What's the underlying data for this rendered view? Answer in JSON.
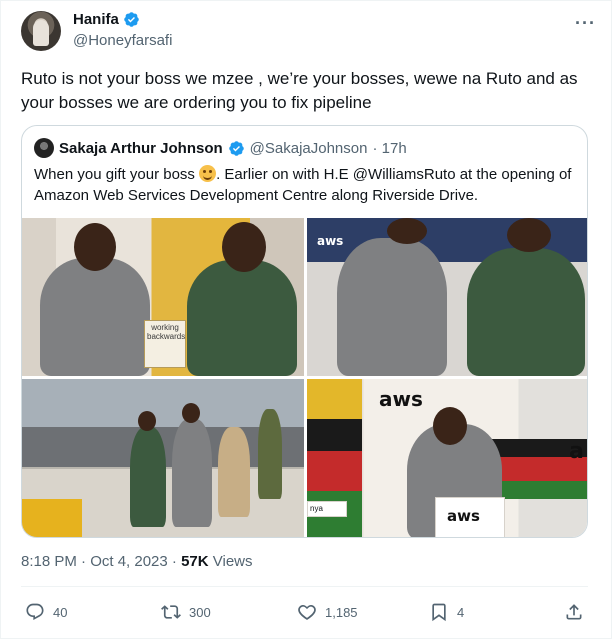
{
  "author": {
    "name": "Hanifa",
    "handle": "@Honeyfarsafi",
    "verified": true
  },
  "tweet": {
    "text": "Ruto is not your boss we mzee , we’re your bosses, wewe na Ruto and as your bosses we are ordering you to fix pipeline"
  },
  "quoted": {
    "name": "Sakaja Arthur Johnson",
    "handle": "@SakajaJohnson",
    "time": "· 17h",
    "text_before_emoji": "When you gift your boss ",
    "text_after_emoji": ". Earlier on with H.E @WilliamsRuto at the opening of Amazon Web Services Development Centre along Riverside Drive.",
    "book_label": "working backwards",
    "aws_logo_1": "aws",
    "aws_logo_2": "aws",
    "aws_logo_3": "aws",
    "sign_fragment": "nya"
  },
  "timestamp": {
    "time": "8:18 PM · Oct 4, 2023 · ",
    "views_count": "57K",
    "views_label": " Views"
  },
  "actions": {
    "replies": "40",
    "retweets": "300",
    "likes": "1,185",
    "bookmarks": "4"
  },
  "icons": {
    "verified": "verified-badge-icon",
    "more": "more-horizontal-icon",
    "reply": "reply-icon",
    "retweet": "retweet-icon",
    "like": "heart-icon",
    "bookmark": "bookmark-icon",
    "share": "share-icon"
  },
  "colors": {
    "verified_blue": "#1d9bf0",
    "text_primary": "#0f1419",
    "text_secondary": "#536471"
  }
}
